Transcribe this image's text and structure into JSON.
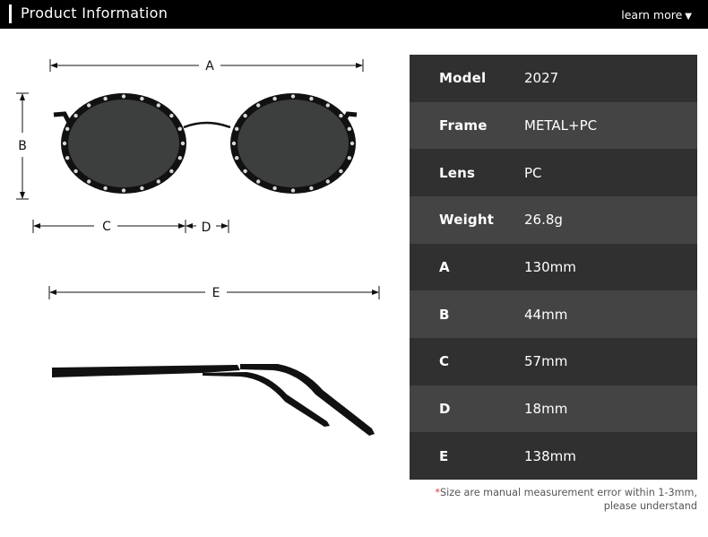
{
  "header": {
    "title": "Product Information",
    "learn_more": "learn more",
    "learn_more_icon": "triangle-down-icon"
  },
  "diagram": {
    "labels": {
      "a": "A",
      "b": "B",
      "c": "C",
      "d": "D",
      "e": "E"
    }
  },
  "specs": [
    {
      "key": "Model",
      "value": "2027"
    },
    {
      "key": "Frame",
      "value": "METAL+PC"
    },
    {
      "key": "Lens",
      "value": "PC"
    },
    {
      "key": "Weight",
      "value": "26.8g"
    },
    {
      "key": "A",
      "value": "130mm"
    },
    {
      "key": "B",
      "value": "44mm"
    },
    {
      "key": "C",
      "value": "57mm"
    },
    {
      "key": "D",
      "value": "18mm"
    },
    {
      "key": "E",
      "value": "138mm"
    }
  ],
  "note": {
    "star": "*",
    "line1": "Size are manual measurement error within 1-3mm,",
    "line2": "please understand"
  },
  "colors": {
    "header_bg": "#000000",
    "row_dark": "#303030",
    "row_light": "#444444",
    "note_star": "#e0393e"
  }
}
